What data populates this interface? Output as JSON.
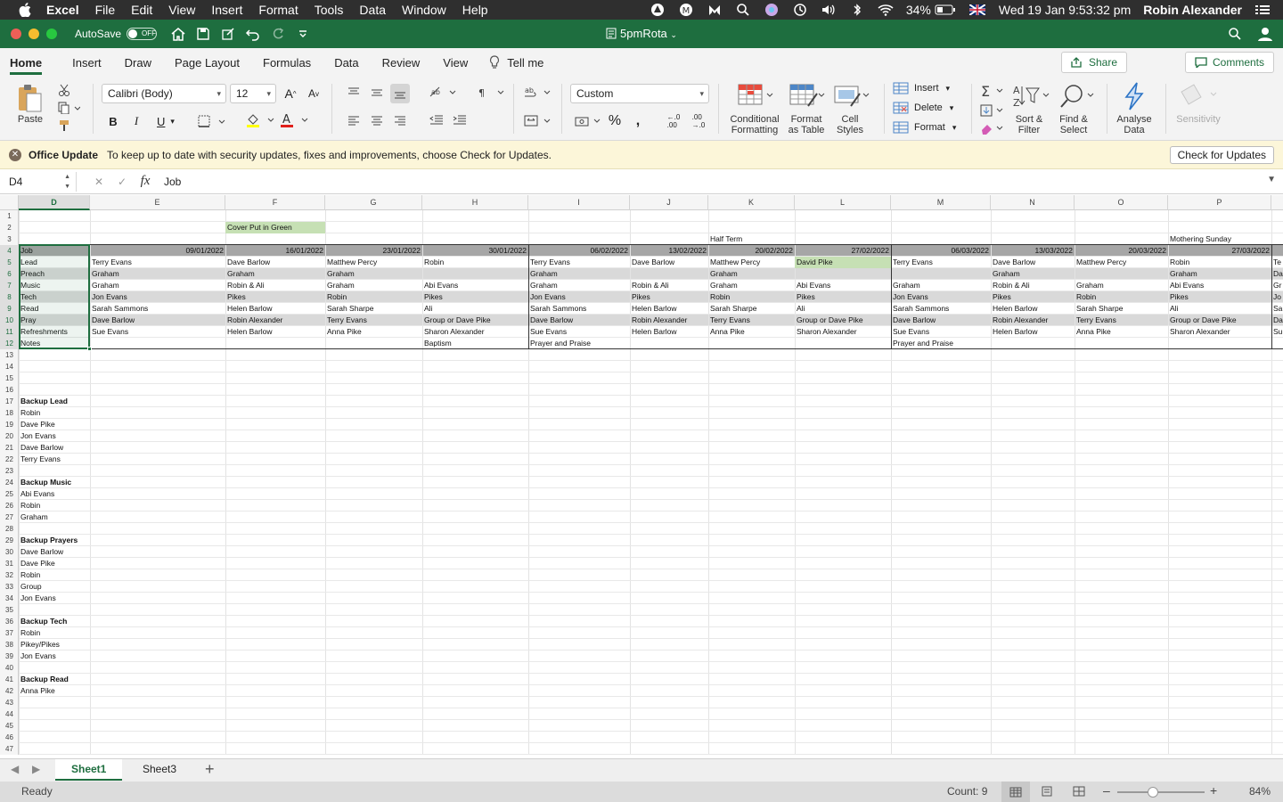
{
  "menubar": {
    "app": "Excel",
    "items": [
      "File",
      "Edit",
      "View",
      "Insert",
      "Format",
      "Tools",
      "Data",
      "Window",
      "Help"
    ],
    "battery": "34%",
    "datetime": "Wed 19 Jan  9:53:32 pm",
    "user": "Robin Alexander"
  },
  "titlebar": {
    "autosave_label": "AutoSave",
    "autosave_state": "OFF",
    "document": "5pmRota"
  },
  "ribbon_tabs": [
    "Home",
    "Insert",
    "Draw",
    "Page Layout",
    "Formulas",
    "Data",
    "Review",
    "View"
  ],
  "tell_me": "Tell me",
  "share_label": "Share",
  "comments_label": "Comments",
  "toolbar": {
    "paste": "Paste",
    "font_name": "Calibri (Body)",
    "font_size": "12",
    "number_format": "Custom",
    "conditional": [
      "Conditional",
      "Formatting"
    ],
    "format_table": [
      "Format",
      "as Table"
    ],
    "cell_styles": [
      "Cell",
      "Styles"
    ],
    "insert": "Insert",
    "delete": "Delete",
    "format": "Format",
    "sort": [
      "Sort &",
      "Filter"
    ],
    "find": [
      "Find &",
      "Select"
    ],
    "analyse": [
      "Analyse",
      "Data"
    ],
    "sensitivity": "Sensitivity"
  },
  "notification": {
    "title": "Office Update",
    "message": "To keep up to date with security updates, fixes and improvements, choose Check for Updates.",
    "button": "Check for Updates"
  },
  "formula_bar": {
    "name_box": "D4",
    "content": "Job"
  },
  "columns": [
    "D",
    "E",
    "F",
    "G",
    "H",
    "I",
    "J",
    "K",
    "L",
    "M",
    "N",
    "O",
    "P"
  ],
  "selected_column": "D",
  "rows": [
    "1",
    "2",
    "3",
    "4",
    "5",
    "6",
    "7",
    "8",
    "9",
    "10",
    "11",
    "12",
    "13",
    "14",
    "15",
    "16",
    "17",
    "18",
    "19",
    "20",
    "21",
    "22",
    "23",
    "24",
    "25",
    "26",
    "27",
    "28",
    "29",
    "30",
    "31",
    "32",
    "33",
    "34",
    "35",
    "36",
    "37",
    "38",
    "39",
    "40",
    "41",
    "42",
    "43",
    "44",
    "45",
    "46",
    "47"
  ],
  "notes_row2": "Cover Put in Green",
  "row3": {
    "K": "Half Term",
    "P": "Mothering Sunday"
  },
  "dates": [
    "09/01/2022",
    "16/01/2022",
    "23/01/2022",
    "30/01/2022",
    "06/02/2022",
    "13/02/2022",
    "20/02/2022",
    "27/02/2022",
    "06/03/2022",
    "13/03/2022",
    "20/03/2022",
    "27/03/2022"
  ],
  "jobs": [
    "Job",
    "Lead",
    "Preach",
    "Music",
    "Tech",
    "Read",
    "Pray",
    "Refreshments",
    "Notes"
  ],
  "rota": {
    "E": [
      "Terry Evans",
      "Graham",
      "Graham",
      "Jon Evans",
      "Sarah Sammons",
      "Dave Barlow",
      "Sue Evans",
      ""
    ],
    "F": [
      "Dave Barlow",
      "Graham",
      "Robin & Ali",
      "Pikes",
      "Helen Barlow",
      "Robin Alexander",
      "Helen Barlow",
      ""
    ],
    "G": [
      "Matthew Percy",
      "Graham",
      "Graham",
      "Robin",
      "Sarah Sharpe",
      "Terry Evans",
      "Anna Pike",
      ""
    ],
    "H": [
      "Robin",
      "",
      "Abi Evans",
      "Pikes",
      "Ali",
      "Group or Dave Pike",
      "Sharon Alexander",
      "Baptism"
    ],
    "I": [
      "Terry Evans",
      "Graham",
      "Graham",
      "Jon Evans",
      "Sarah Sammons",
      "Dave Barlow",
      "Sue Evans",
      "Prayer and Praise"
    ],
    "J": [
      "Dave Barlow",
      "",
      "Robin & Ali",
      "Pikes",
      "Helen Barlow",
      "Robin Alexander",
      "Helen Barlow",
      ""
    ],
    "K": [
      "Matthew Percy",
      "Graham",
      "Graham",
      "Robin",
      "Sarah Sharpe",
      "Terry Evans",
      "Anna Pike",
      ""
    ],
    "L": [
      "David Pike",
      "",
      "Abi Evans",
      "Pikes",
      "Ali",
      "Group or Dave Pike",
      "Sharon Alexander",
      ""
    ],
    "M": [
      "Terry Evans",
      "",
      "Graham",
      "Jon Evans",
      "Sarah Sammons",
      "Dave Barlow",
      "Sue Evans",
      "Prayer and Praise"
    ],
    "N": [
      "Dave Barlow",
      "Graham",
      "Robin & Ali",
      "Pikes",
      "Helen Barlow",
      "Robin Alexander",
      "Helen Barlow",
      ""
    ],
    "O": [
      "Matthew Percy",
      "",
      "Graham",
      "Robin",
      "Sarah Sharpe",
      "Terry Evans",
      "Anna Pike",
      ""
    ],
    "P": [
      "Robin",
      "Graham",
      "Abi Evans",
      "Pikes",
      "Ali",
      "Group or Dave Pike",
      "Sharon Alexander",
      ""
    ],
    "Q": [
      "Te",
      "Da",
      "Gr",
      "Jo",
      "Sa",
      "Da",
      "Su",
      ""
    ]
  },
  "backups": [
    {
      "row": 17,
      "text": "Backup Lead",
      "bold": true
    },
    {
      "row": 18,
      "text": "Robin"
    },
    {
      "row": 19,
      "text": "Dave Pike"
    },
    {
      "row": 20,
      "text": "Jon Evans"
    },
    {
      "row": 21,
      "text": "Dave Barlow"
    },
    {
      "row": 22,
      "text": "Terry Evans"
    },
    {
      "row": 24,
      "text": "Backup Music",
      "bold": true
    },
    {
      "row": 25,
      "text": "Abi Evans"
    },
    {
      "row": 26,
      "text": "Robin"
    },
    {
      "row": 27,
      "text": "Graham"
    },
    {
      "row": 29,
      "text": "Backup Prayers",
      "bold": true
    },
    {
      "row": 30,
      "text": "Dave Barlow"
    },
    {
      "row": 31,
      "text": "Dave Pike"
    },
    {
      "row": 32,
      "text": "Robin"
    },
    {
      "row": 33,
      "text": "Group"
    },
    {
      "row": 34,
      "text": "Jon Evans"
    },
    {
      "row": 36,
      "text": "Backup Tech",
      "bold": true
    },
    {
      "row": 37,
      "text": "Robin"
    },
    {
      "row": 38,
      "text": "Pikey/Pikes"
    },
    {
      "row": 39,
      "text": "Jon Evans"
    },
    {
      "row": 41,
      "text": "Backup Read",
      "bold": true
    },
    {
      "row": 42,
      "text": "Anna Pike"
    }
  ],
  "sheets": [
    "Sheet1",
    "Sheet3"
  ],
  "status": {
    "ready": "Ready",
    "count": "Count: 9",
    "zoom": "84%"
  },
  "colors": {
    "excel_green": "#1e6e3f",
    "cover_green": "#c6e0b4",
    "band_grey": "#d9d9d9",
    "header_grey": "#a6a6a6"
  }
}
